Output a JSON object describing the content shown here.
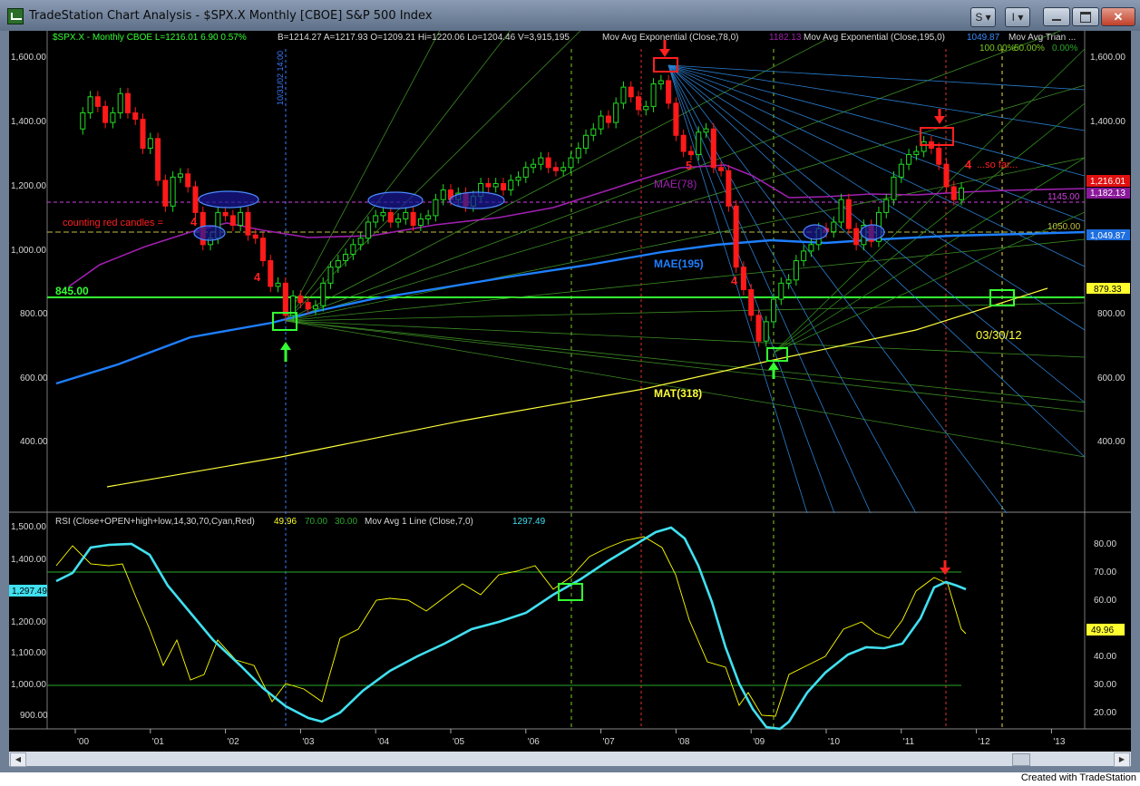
{
  "window": {
    "title": "TradeStation Chart Analysis - $SPX.X Monthly [CBOE] S&P 500 Index",
    "buttons": {
      "s": "S",
      "i": "I"
    }
  },
  "status": {
    "symbol_info": "$SPX.X - Monthly  CBOE  L=1216.01  6.90  0.57%",
    "bid_ask": "B=1214.27  A=1217.93  O=1209.21  Hi=1220.06  Lo=1204.46  V=3,915,195",
    "mae78_label": "Mov Avg Exponential (Close,78,0)",
    "mae78_value": "1182.13",
    "mae195_label": "Mov Avg Exponential (Close,195,0)",
    "mae195_value": "1049.87",
    "mat_label": "Mov Avg Trian ...",
    "fib_labels": [
      "100.00%",
      "50.00%",
      "0.00%"
    ]
  },
  "price_axis": {
    "ticks": [
      "1,600.00",
      "1,400.00",
      "1,200.00",
      "1,000.00",
      "800.00",
      "600.00",
      "400.00"
    ],
    "flags": {
      "last": "1,216.01",
      "mae78": "1,182.13",
      "mae195": "1,049.87",
      "level": "879.33"
    }
  },
  "annotations": {
    "counting": "counting  red candles =",
    "count_4a": "4",
    "count_4b": "4",
    "count_5": "5",
    "count_4c": "4",
    "count_4d": "4",
    "so_far": "...so far...",
    "mae78": "MAE(78)",
    "mae195": "MAE(195)",
    "mat318": "MAT(318)",
    "level_845": "845.00",
    "level_1145": "1145.00",
    "level_1050": "1050.00",
    "date_target": "03/30/12",
    "vertical_date": "10/31/02 14:00"
  },
  "rsi": {
    "label": "RSI (Close+OPEN+high+low,14,30,70,Cyan,Red)",
    "value": "49.96",
    "ob": "70.00",
    "os": "30.00",
    "mavg_label": "Mov Avg 1 Line (Close,7,0)",
    "mavg_value": "1297.49",
    "left_ticks": [
      "1,500.00",
      "1,400.00",
      "1,300.00",
      "1,200.00",
      "1,100.00",
      "1,000.00",
      "900.00"
    ],
    "left_flag": "1,297.49",
    "right_ticks": [
      "80.00",
      "70.00",
      "60.00",
      "50.00",
      "40.00",
      "30.00",
      "20.00"
    ],
    "right_flag": "49.96"
  },
  "time_axis": [
    "'00",
    "'01",
    "'02",
    "'03",
    "'04",
    "'05",
    "'06",
    "'07",
    "'08",
    "'09",
    "'10",
    "'11",
    "'12",
    "'13"
  ],
  "footer": "Created with TradeStation",
  "colors": {
    "up": "#22dd22",
    "down": "#ff1a1a",
    "mae78": "#a020b0",
    "mae195": "#1e7fff",
    "mat": "#ffff3c",
    "rsi": "#ffff00",
    "mavg": "#40e0f0",
    "green_level": "#33ff33"
  }
}
